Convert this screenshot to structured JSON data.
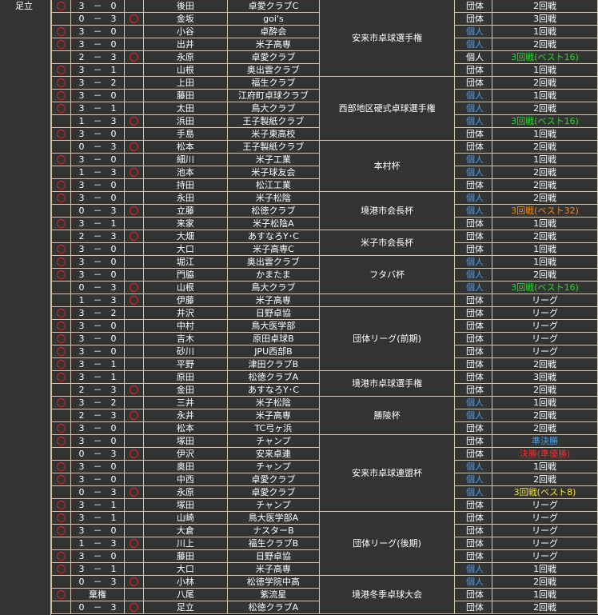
{
  "player_name": "足立",
  "colors": {
    "green": "#2bd82b",
    "orange": "#f08a1c",
    "yellow": "#f2e52e",
    "red": "#ff2a2a",
    "blue": "#4aa3f0"
  },
  "tournaments": [
    {
      "name": "安来市卓球選手権",
      "rows": 6
    },
    {
      "name": "西部地区硬式卓球選手権",
      "rows": 5
    },
    {
      "name": "本村杯",
      "rows": 4
    },
    {
      "name": "境港市会長杯",
      "rows": 3
    },
    {
      "name": "米子市会長杯",
      "rows": 2
    },
    {
      "name": "フタバ杯",
      "rows": 3
    },
    {
      "name": "",
      "rows": 1
    },
    {
      "name": "団体リーグ(前期)",
      "rows": 5
    },
    {
      "name": "境港市卓球選手権",
      "rows": 2
    },
    {
      "name": "勝陵杯",
      "rows": 3
    },
    {
      "name": "安来市卓球連盟杯",
      "rows": 6
    },
    {
      "name": "団体リーグ(後期)",
      "rows": 5
    },
    {
      "name": "境港冬季卓球大会",
      "rows": 4
    }
  ],
  "matches": [
    {
      "w": true,
      "score": "3　－　0",
      "l": false,
      "name": "後田",
      "opp": "卓愛クラブC",
      "kind": "団体",
      "kc": "team",
      "res": "2回戦",
      "rc": ""
    },
    {
      "w": false,
      "score": "0　－　3",
      "l": true,
      "name": "金坂",
      "opp": "goi's",
      "kind": "団体",
      "kc": "team",
      "res": "3回戦",
      "rc": ""
    },
    {
      "w": true,
      "score": "3　－　0",
      "l": false,
      "name": "小谷",
      "opp": "卓酔会",
      "kind": "個人",
      "kc": "indiv",
      "res": "1回戦",
      "rc": ""
    },
    {
      "w": true,
      "score": "3　－　0",
      "l": false,
      "name": "出井",
      "opp": "米子高専",
      "kind": "個人",
      "kc": "indiv",
      "res": "2回戦",
      "rc": ""
    },
    {
      "w": false,
      "score": "2　－　3",
      "l": true,
      "name": "永原",
      "opp": "卓愛クラブ",
      "kind": "個人",
      "kc": "team",
      "res": "3回戦(ベスト16)",
      "rc": "green"
    },
    {
      "w": true,
      "score": "3　－　1",
      "l": false,
      "name": "山根",
      "opp": "奥出雲クラブ",
      "kind": "団体",
      "kc": "team",
      "res": "1回戦",
      "rc": ""
    },
    {
      "w": true,
      "score": "3　－　2",
      "l": false,
      "name": "上田",
      "opp": "福生クラブ",
      "kind": "団体",
      "kc": "team",
      "res": "2回戦",
      "rc": ""
    },
    {
      "w": true,
      "score": "3　－　0",
      "l": false,
      "name": "藤田",
      "opp": "江府町卓球クラブ",
      "kind": "個人",
      "kc": "indiv",
      "res": "1回戦",
      "rc": ""
    },
    {
      "w": true,
      "score": "3　－　1",
      "l": false,
      "name": "太田",
      "opp": "鳥大クラブ",
      "kind": "個人",
      "kc": "indiv",
      "res": "2回戦",
      "rc": ""
    },
    {
      "w": false,
      "score": "1　－　3",
      "l": true,
      "name": "浜田",
      "opp": "王子製紙クラブ",
      "kind": "個人",
      "kc": "indiv",
      "res": "3回戦(ベスト16)",
      "rc": "green"
    },
    {
      "w": true,
      "score": "3　－　0",
      "l": false,
      "name": "手島",
      "opp": "米子東高校",
      "kind": "団体",
      "kc": "team",
      "res": "1回戦",
      "rc": ""
    },
    {
      "w": false,
      "score": "0　－　3",
      "l": true,
      "name": "松本",
      "opp": "王子製紙クラブ",
      "kind": "団体",
      "kc": "team",
      "res": "2回戦",
      "rc": ""
    },
    {
      "w": true,
      "score": "3　－　0",
      "l": false,
      "name": "細川",
      "opp": "米子工業",
      "kind": "個人",
      "kc": "indiv",
      "res": "1回戦",
      "rc": ""
    },
    {
      "w": false,
      "score": "1　－　3",
      "l": true,
      "name": "池本",
      "opp": "米子球友会",
      "kind": "個人",
      "kc": "indiv",
      "res": "2回戦",
      "rc": ""
    },
    {
      "w": true,
      "score": "3　－　0",
      "l": false,
      "name": "持田",
      "opp": "松江工業",
      "kind": "団体",
      "kc": "team",
      "res": "2回戦",
      "rc": ""
    },
    {
      "w": true,
      "score": "3　－　0",
      "l": false,
      "name": "永田",
      "opp": "米子松陰",
      "kind": "個人",
      "kc": "indiv",
      "res": "2回戦",
      "rc": ""
    },
    {
      "w": false,
      "score": "0　－　3",
      "l": true,
      "name": "立藤",
      "opp": "松徳クラブ",
      "kind": "個人",
      "kc": "indiv",
      "res": "3回戦(ベスト32)",
      "rc": "orange"
    },
    {
      "w": true,
      "score": "3　－　1",
      "l": false,
      "name": "来家",
      "opp": "米子松陰A",
      "kind": "団体",
      "kc": "team",
      "res": "1回戦",
      "rc": ""
    },
    {
      "w": false,
      "score": "2　－　3",
      "l": true,
      "name": "大畑",
      "opp": "あすなろY･C",
      "kind": "団体",
      "kc": "team",
      "res": "2回戦",
      "rc": ""
    },
    {
      "w": true,
      "score": "3　－　0",
      "l": false,
      "name": "大口",
      "opp": "米子高専C",
      "kind": "団体",
      "kc": "team",
      "res": "1回戦",
      "rc": ""
    },
    {
      "w": true,
      "score": "3　－　0",
      "l": false,
      "name": "堀江",
      "opp": "奥出雲クラブ",
      "kind": "個人",
      "kc": "indiv",
      "res": "1回戦",
      "rc": ""
    },
    {
      "w": true,
      "score": "3　－　0",
      "l": false,
      "name": "門脇",
      "opp": "かまたま",
      "kind": "個人",
      "kc": "indiv",
      "res": "2回戦",
      "rc": ""
    },
    {
      "w": false,
      "score": "0　－　3",
      "l": true,
      "name": "山根",
      "opp": "鳥大クラブ",
      "kind": "個人",
      "kc": "indiv",
      "res": "3回戦(ベスト16)",
      "rc": "green"
    },
    {
      "w": false,
      "score": "1　－　3",
      "l": true,
      "name": "伊藤",
      "opp": "米子高専",
      "kind": "団体",
      "kc": "team",
      "res": "リーグ",
      "rc": ""
    },
    {
      "w": true,
      "score": "3　－　2",
      "l": false,
      "name": "井沢",
      "opp": "日野卓協",
      "kind": "団体",
      "kc": "team",
      "res": "リーグ",
      "rc": ""
    },
    {
      "w": true,
      "score": "3　－　0",
      "l": false,
      "name": "中村",
      "opp": "鳥大医学部",
      "kind": "団体",
      "kc": "team",
      "res": "リーグ",
      "rc": ""
    },
    {
      "w": true,
      "score": "3　－　0",
      "l": false,
      "name": "吉木",
      "opp": "原田卓球B",
      "kind": "団体",
      "kc": "team",
      "res": "リーグ",
      "rc": ""
    },
    {
      "w": true,
      "score": "3　－　0",
      "l": false,
      "name": "砂川",
      "opp": "JPU西部B",
      "kind": "団体",
      "kc": "team",
      "res": "リーグ",
      "rc": ""
    },
    {
      "w": true,
      "score": "3　－　1",
      "l": false,
      "name": "平野",
      "opp": "津田クラブB",
      "kind": "団体",
      "kc": "team",
      "res": "2回戦",
      "rc": ""
    },
    {
      "w": true,
      "score": "3　－　1",
      "l": false,
      "name": "原田",
      "opp": "松徳クラブA",
      "kind": "団体",
      "kc": "team",
      "res": "3回戦",
      "rc": ""
    },
    {
      "w": false,
      "score": "2　－　3",
      "l": true,
      "name": "金田",
      "opp": "あすなろY･C",
      "kind": "団体",
      "kc": "team",
      "res": "2回戦",
      "rc": ""
    },
    {
      "w": true,
      "score": "3　－　2",
      "l": false,
      "name": "三井",
      "opp": "米子松陰",
      "kind": "個人",
      "kc": "indiv",
      "res": "1回戦",
      "rc": ""
    },
    {
      "w": false,
      "score": "2　－　3",
      "l": true,
      "name": "永井",
      "opp": "米子高専",
      "kind": "個人",
      "kc": "indiv",
      "res": "2回戦",
      "rc": ""
    },
    {
      "w": true,
      "score": "3　－　0",
      "l": false,
      "name": "松本",
      "opp": "TC弓ヶ浜",
      "kind": "団体",
      "kc": "team",
      "res": "2回戦",
      "rc": ""
    },
    {
      "w": true,
      "score": "3　－　0",
      "l": false,
      "name": "塚田",
      "opp": "チャンプ",
      "kind": "団体",
      "kc": "team",
      "res": "準決勝",
      "rc": "blue"
    },
    {
      "w": false,
      "score": "0　－　3",
      "l": true,
      "name": "伊沢",
      "opp": "安来卓連",
      "kind": "団体",
      "kc": "team",
      "res": "決勝(準優勝)",
      "rc": "red"
    },
    {
      "w": true,
      "score": "3　－　0",
      "l": false,
      "name": "奥田",
      "opp": "チャンプ",
      "kind": "個人",
      "kc": "indiv",
      "res": "1回戦",
      "rc": ""
    },
    {
      "w": true,
      "score": "3　－　0",
      "l": false,
      "name": "中西",
      "opp": "卓愛クラブ",
      "kind": "個人",
      "kc": "indiv",
      "res": "2回戦",
      "rc": ""
    },
    {
      "w": false,
      "score": "0　－　3",
      "l": true,
      "name": "永原",
      "opp": "卓愛クラブ",
      "kind": "個人",
      "kc": "indiv",
      "res": "3回戦(ベスト8)",
      "rc": "yellow"
    },
    {
      "w": true,
      "score": "3　－　1",
      "l": false,
      "name": "塚田",
      "opp": "チャンプ",
      "kind": "団体",
      "kc": "team",
      "res": "リーグ",
      "rc": ""
    },
    {
      "w": true,
      "score": "3　－　1",
      "l": false,
      "name": "山崎",
      "opp": "鳥大医学部A",
      "kind": "団体",
      "kc": "team",
      "res": "リーグ",
      "rc": ""
    },
    {
      "w": true,
      "score": "3　－　0",
      "l": false,
      "name": "大倉",
      "opp": "ナスターB",
      "kind": "団体",
      "kc": "team",
      "res": "リーグ",
      "rc": ""
    },
    {
      "w": false,
      "score": "1　－　3",
      "l": true,
      "name": "川上",
      "opp": "福生クラブB",
      "kind": "団体",
      "kc": "team",
      "res": "リーグ",
      "rc": ""
    },
    {
      "w": true,
      "score": "3　－　0",
      "l": false,
      "name": "藤田",
      "opp": "日野卓協",
      "kind": "団体",
      "kc": "team",
      "res": "リーグ",
      "rc": ""
    },
    {
      "w": true,
      "score": "3　－　1",
      "l": false,
      "name": "大口",
      "opp": "米子高専",
      "kind": "個人",
      "kc": "indiv",
      "res": "1回戦",
      "rc": ""
    },
    {
      "w": false,
      "score": "0　－　3",
      "l": true,
      "name": "小林",
      "opp": "松徳学院中高",
      "kind": "個人",
      "kc": "indiv",
      "res": "2回戦",
      "rc": ""
    },
    {
      "w": true,
      "score": "棄権",
      "l": false,
      "name": "八尾",
      "opp": "紫流星",
      "kind": "団体",
      "kc": "team",
      "res": "1回戦",
      "rc": ""
    },
    {
      "w": false,
      "score": "0　－　3",
      "l": true,
      "name": "足立",
      "opp": "松徳クラブA",
      "kind": "団体",
      "kc": "team",
      "res": "2回戦",
      "rc": ""
    }
  ]
}
